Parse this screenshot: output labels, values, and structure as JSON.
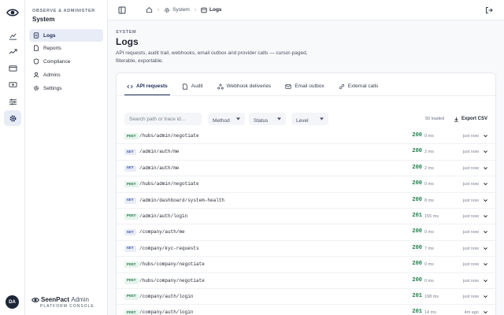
{
  "nav": {
    "eyebrow": "OBSERVE & ADMINISTER",
    "title": "System",
    "items": [
      {
        "label": "Logs",
        "icon": "logs-icon",
        "active": true
      },
      {
        "label": "Reports",
        "icon": "reports-icon",
        "active": false
      },
      {
        "label": "Compliance",
        "icon": "compliance-icon",
        "active": false
      },
      {
        "label": "Admins",
        "icon": "admins-icon",
        "active": false
      },
      {
        "label": "Settings",
        "icon": "settings-icon",
        "active": false
      }
    ]
  },
  "rail": {
    "items": [
      "analytics-icon",
      "trend-icon",
      "wallet-icon",
      "cash-icon",
      "sliders-icon",
      "gear-icon"
    ],
    "active_index": 5
  },
  "user": {
    "initials": "DA"
  },
  "brand": {
    "name_bold": "SeenPact",
    "name_light": "Admin",
    "subtitle": "PLATFORM CONSOLE"
  },
  "breadcrumb": {
    "system": "System",
    "current": "Logs"
  },
  "page": {
    "eyebrow": "SYSTEM",
    "title": "Logs",
    "description": "API requests, audit trail, webhooks, email outbox and provider calls — cursor-paged, filterable, exportable."
  },
  "tabs": [
    {
      "label": "API requests",
      "active": true
    },
    {
      "label": "Audit",
      "active": false
    },
    {
      "label": "Webhook deliveries",
      "active": false
    },
    {
      "label": "Email outbox",
      "active": false
    },
    {
      "label": "External calls",
      "active": false
    }
  ],
  "filters": {
    "search_placeholder": "Search path or trace id…",
    "method": "Method",
    "status": "Status",
    "level": "Level",
    "loaded": "50 loaded",
    "export": "Export CSV"
  },
  "colors": {
    "accent": "#1d2a55",
    "success": "#1e7a4a",
    "post_bg": "#e5f4ec",
    "get_bg": "#e8ecf8"
  },
  "rows": [
    {
      "method": "POST",
      "path": "/hubs/admin/negotiate",
      "status": "200",
      "duration": "0 ms",
      "time": "just now"
    },
    {
      "method": "GET",
      "path": "/admin/auth/me",
      "status": "200",
      "duration": "2 ms",
      "time": "just now"
    },
    {
      "method": "GET",
      "path": "/admin/auth/me",
      "status": "200",
      "duration": "2 ms",
      "time": "just now"
    },
    {
      "method": "POST",
      "path": "/hubs/admin/negotiate",
      "status": "200",
      "duration": "0 ms",
      "time": "just now"
    },
    {
      "method": "GET",
      "path": "/admin/dashboard/system-health",
      "status": "200",
      "duration": "8 ms",
      "time": "just now"
    },
    {
      "method": "POST",
      "path": "/admin/auth/login",
      "status": "201",
      "duration": "155 ms",
      "time": "just now"
    },
    {
      "method": "GET",
      "path": "/company/auth/me",
      "status": "200",
      "duration": "0 ms",
      "time": "just now"
    },
    {
      "method": "GET",
      "path": "/company/kyc-requests",
      "status": "200",
      "duration": "7 ms",
      "time": "just now"
    },
    {
      "method": "POST",
      "path": "/hubs/company/negotiate",
      "status": "200",
      "duration": "0 ms",
      "time": "just now"
    },
    {
      "method": "POST",
      "path": "/hubs/company/negotiate",
      "status": "200",
      "duration": "0 ms",
      "time": "just now"
    },
    {
      "method": "POST",
      "path": "/company/auth/login",
      "status": "201",
      "duration": "198 ms",
      "time": "just now"
    },
    {
      "method": "POST",
      "path": "/company/auth/login",
      "status": "201",
      "duration": "14 ms",
      "time": "4m ago"
    }
  ]
}
